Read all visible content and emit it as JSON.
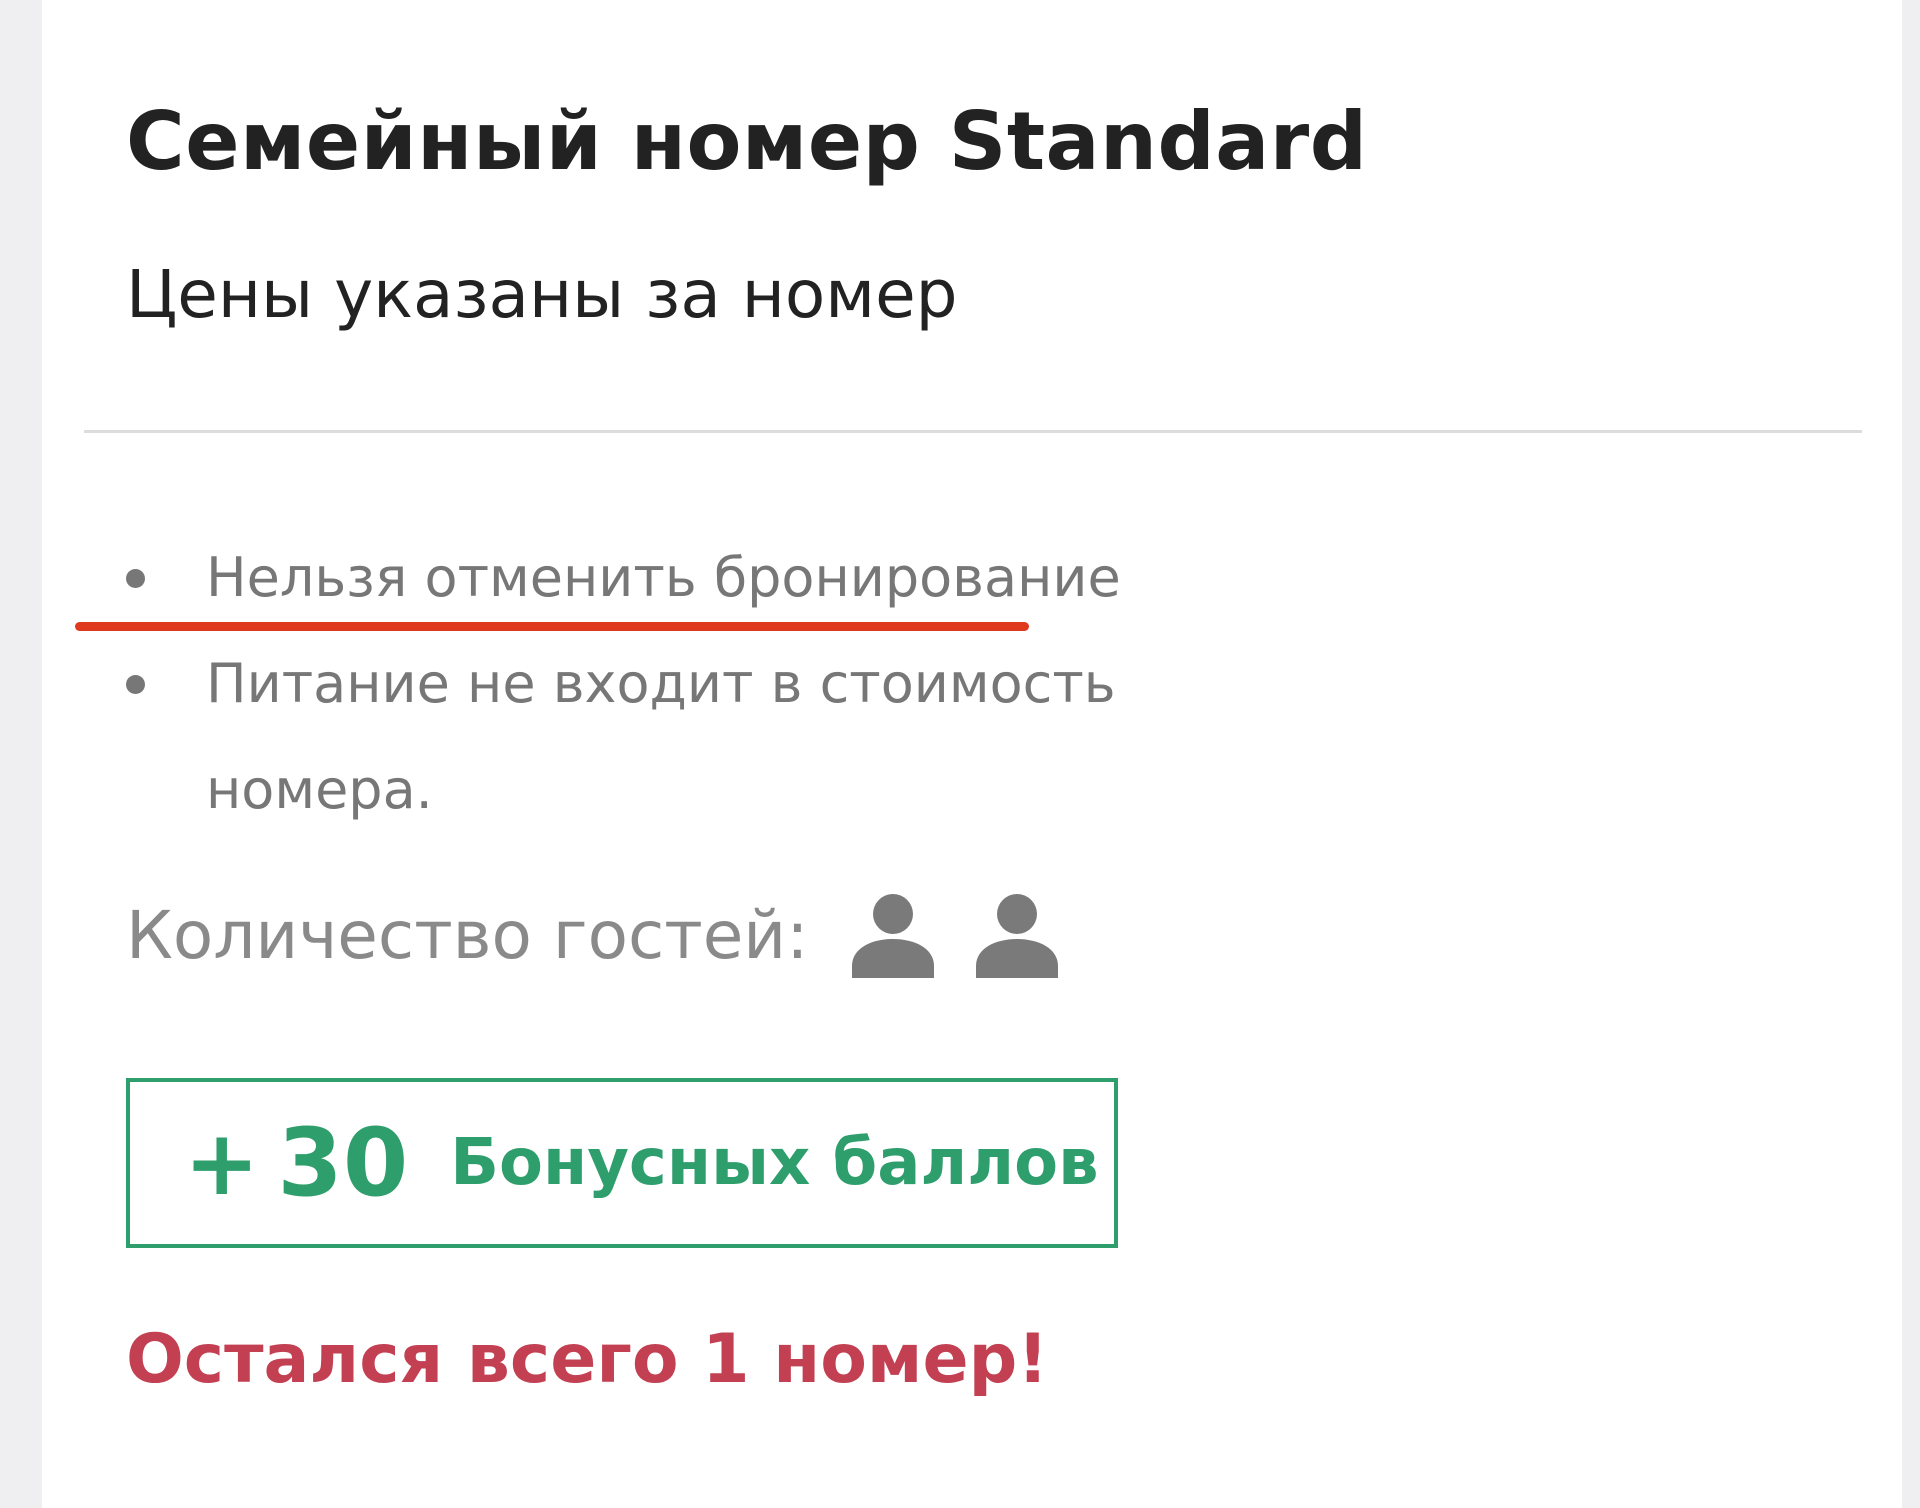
{
  "room": {
    "title": "Семейный номер Standard",
    "price_note": "Цены указаны за номер"
  },
  "conditions": [
    {
      "text": "Нельзя отменить бронирование",
      "highlighted": true
    },
    {
      "text": "Питание не входит в стоимость номера.",
      "highlighted": false
    }
  ],
  "guests": {
    "label": "Количество гостей:",
    "count": 2,
    "icon": "person-icon"
  },
  "bonus": {
    "plus": "+",
    "amount": "30",
    "label": "Бонусных баллов"
  },
  "availability": {
    "text": "Остался всего 1 номер!"
  },
  "colors": {
    "accent_green": "#2f9e6d",
    "warning_red": "#c24052",
    "highlight_underline": "#e03a1e",
    "muted_text": "#777777",
    "primary_text": "#222222"
  }
}
